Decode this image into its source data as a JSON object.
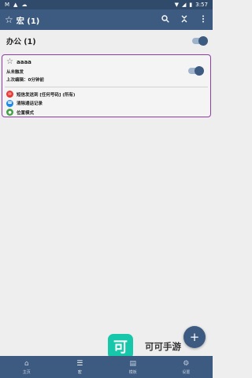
{
  "status_bar": {
    "left_icons": [
      "notification-m-icon",
      "notification-a-icon",
      "notification-cloud-icon"
    ],
    "time": "3:57"
  },
  "app_bar": {
    "title": "宏 (1)"
  },
  "group": {
    "name": "办公 (1)",
    "enabled": true
  },
  "macro": {
    "name": "aaaa",
    "trigger_text": "从未触发",
    "last_edited": "上次编辑：0分钟前",
    "enabled": true,
    "actions": [
      {
        "label": "短信发送到 [任何号码] (所有)",
        "color": "#e53935",
        "icon": "sms-icon"
      },
      {
        "label": "清除通话记录",
        "color": "#1e88e5",
        "icon": "call-log-icon"
      },
      {
        "label": "位置模式",
        "color": "#43a047",
        "icon": "location-icon"
      }
    ]
  },
  "fab": {
    "label": "+"
  },
  "watermark": {
    "logo_char": "可",
    "text": "可可手游"
  },
  "bottom_nav": [
    {
      "label": "主页",
      "icon": "home-icon",
      "active": false
    },
    {
      "label": "宏",
      "icon": "list-icon",
      "active": true
    },
    {
      "label": "模板",
      "icon": "template-icon",
      "active": false
    },
    {
      "label": "设置",
      "icon": "gear-icon",
      "active": false
    }
  ],
  "colors": {
    "primary": "#3d5a80",
    "status_bar": "#2f4a6b",
    "card_border": "#8e3ba6",
    "watermark": "#17c7a9"
  }
}
